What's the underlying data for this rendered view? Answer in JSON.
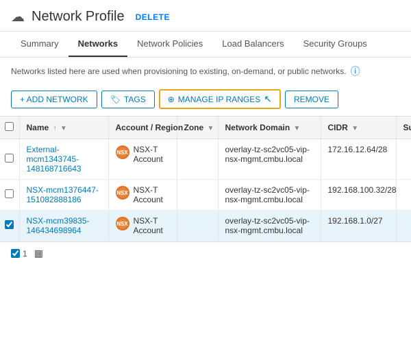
{
  "header": {
    "icon": "☁",
    "title": "Network Profile",
    "delete_label": "DELETE"
  },
  "tabs": [
    {
      "label": "Summary",
      "active": false
    },
    {
      "label": "Networks",
      "active": true
    },
    {
      "label": "Network Policies",
      "active": false
    },
    {
      "label": "Load Balancers",
      "active": false
    },
    {
      "label": "Security Groups",
      "active": false
    }
  ],
  "info_text": "Networks listed here are used when provisioning to existing, on-demand, or public networks.",
  "toolbar": {
    "add_label": "+ ADD NETWORK",
    "tags_label": "TAGS",
    "manage_label": "⊕ MANAGE IP RANGES",
    "remove_label": "REMOVE"
  },
  "table": {
    "columns": [
      {
        "label": "Name",
        "sortable": true,
        "filterable": true
      },
      {
        "label": "Account / Region",
        "sortable": false,
        "filterable": false
      },
      {
        "label": "Zone",
        "sortable": false,
        "filterable": true
      },
      {
        "label": "Network Domain",
        "sortable": false,
        "filterable": true
      },
      {
        "label": "CIDR",
        "sortable": false,
        "filterable": true
      },
      {
        "label": "Su Pu",
        "sortable": false,
        "filterable": false
      }
    ],
    "rows": [
      {
        "checked": false,
        "name": "External-mcm1343745-148168716643",
        "account_icon": "NSX",
        "account": "NSX-T Account",
        "zone": "",
        "domain": "overlay-tz-sc2vc05-vip-nsx-mgmt.cmbu.local",
        "cidr": "172.16.12.64/28",
        "su": "",
        "selected": false
      },
      {
        "checked": false,
        "name": "NSX-mcm1376447-151082888186",
        "account_icon": "NSX",
        "account": "NSX-T Account",
        "zone": "",
        "domain": "overlay-tz-sc2vc05-vip-nsx-mgmt.cmbu.local",
        "cidr": "192.168.100.32/28",
        "su": "",
        "selected": false
      },
      {
        "checked": true,
        "name": "NSX-mcm39835-146434698964",
        "account_icon": "NSX",
        "account": "NSX-T Account",
        "zone": "",
        "domain": "overlay-tz-sc2vc05-vip-nsx-mgmt.cmbu.local",
        "cidr": "192.168.1.0/27",
        "su": "",
        "selected": true
      }
    ]
  },
  "footer": {
    "count": "1",
    "icon": "▦"
  }
}
